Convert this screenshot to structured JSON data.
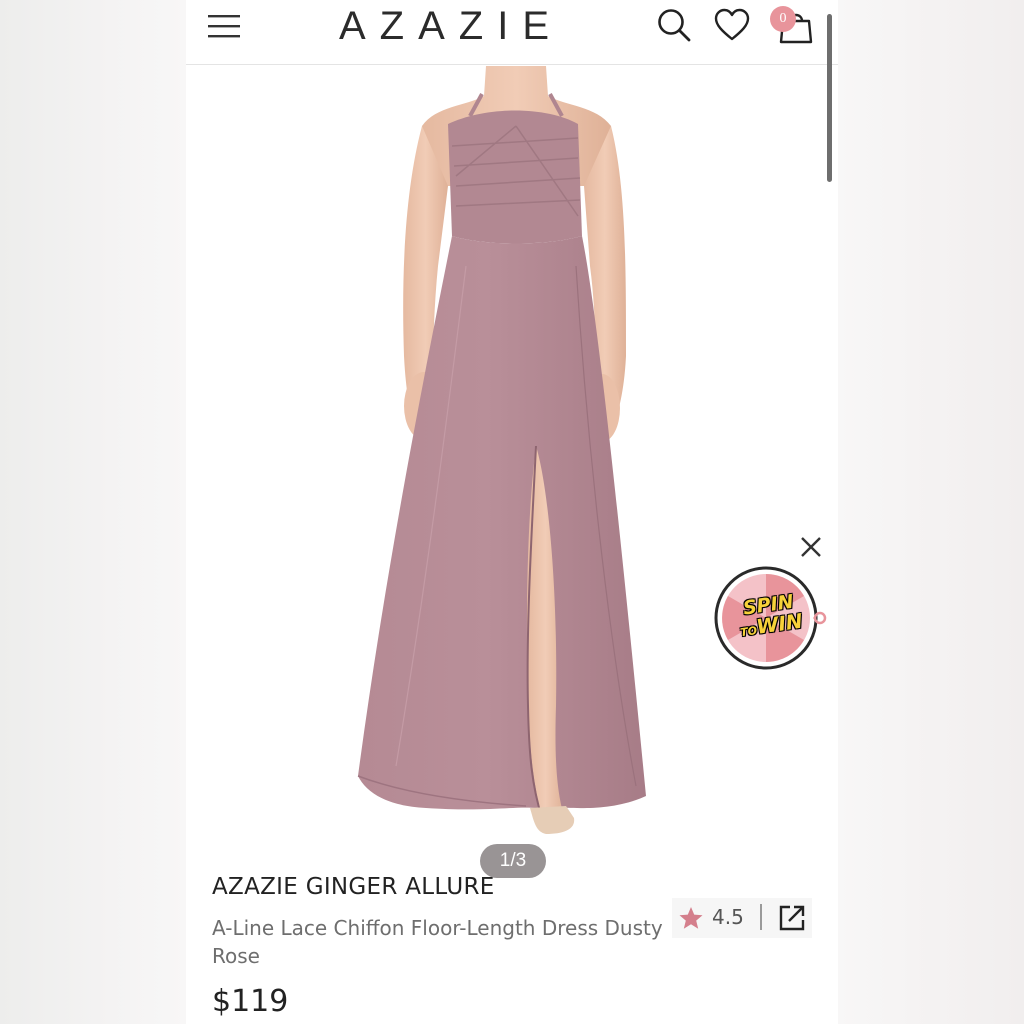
{
  "header": {
    "logo_text": "AZAZIE",
    "cart_count": "0"
  },
  "gallery": {
    "pager_text": "1/3",
    "dress_color": "#b08690"
  },
  "promo": {
    "spin_word": "SPIN",
    "to_word": "TO",
    "win_word": "WIN"
  },
  "product": {
    "brand_title": "AZAZIE GINGER ALLURE",
    "subtitle": "A-Line Lace Chiffon Floor-Length Dress Dusty Rose",
    "rating": "4.5",
    "price": "$119"
  },
  "colors": {
    "accent_pink": "#e8949b",
    "star": "#d47f8c"
  }
}
